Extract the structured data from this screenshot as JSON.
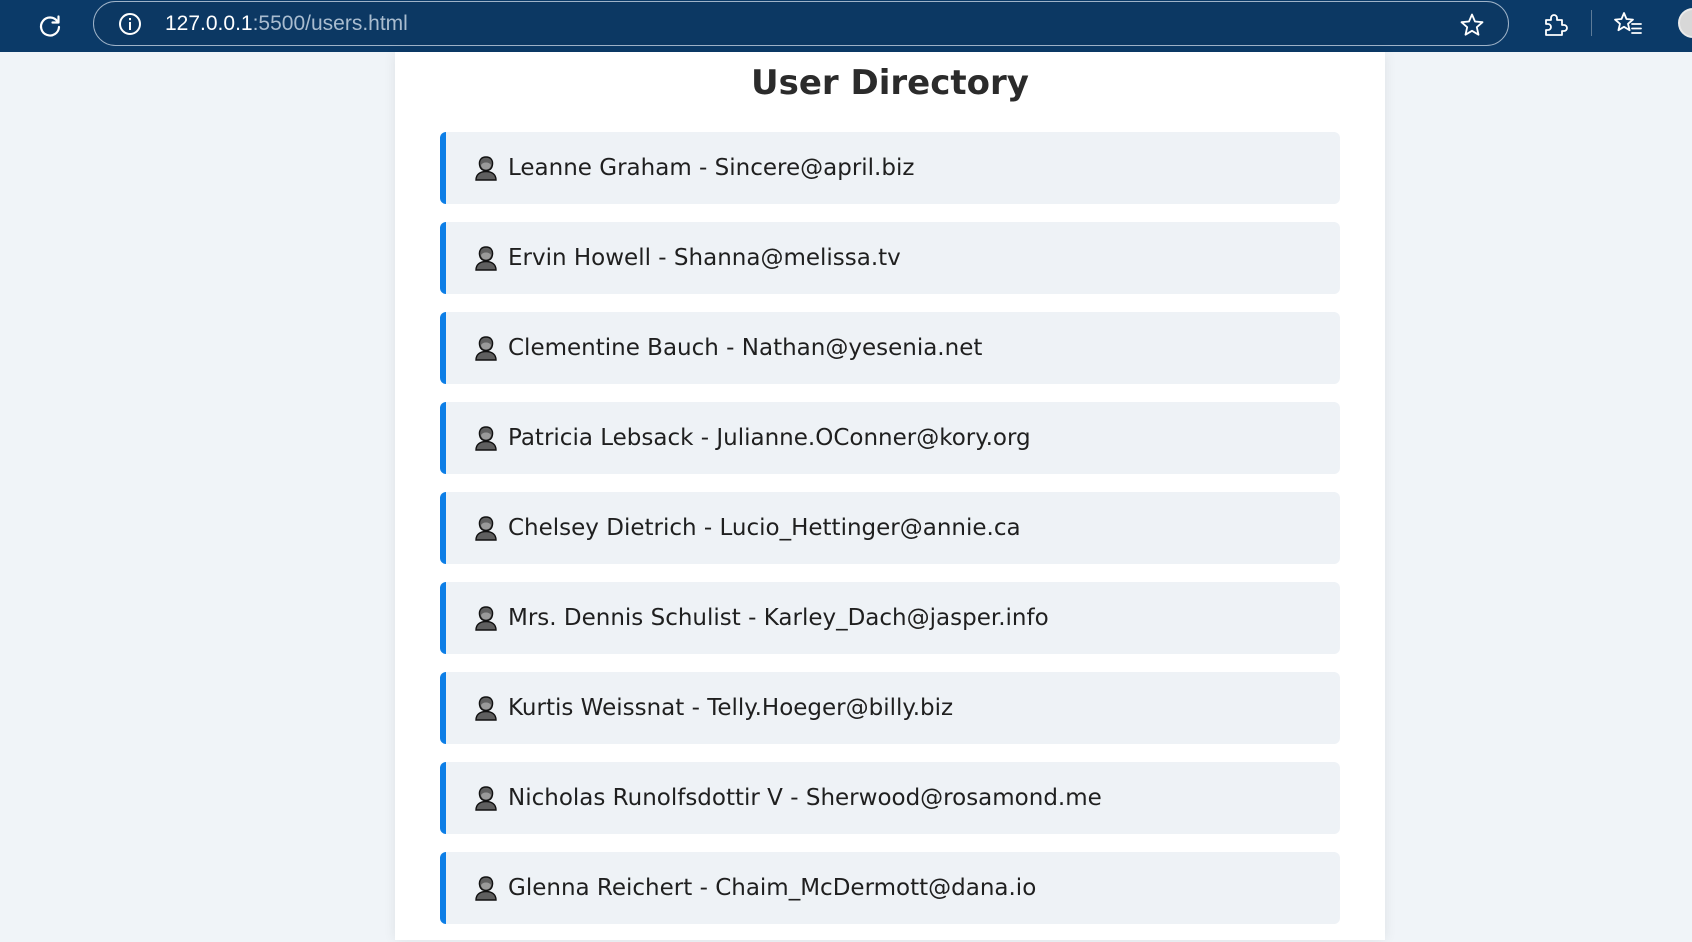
{
  "browser": {
    "url_host": "127.0.0.1",
    "url_path": ":5500/users.html",
    "icons": {
      "reload": "reload-icon",
      "info": "info-icon",
      "bookmark": "star-icon",
      "extensions": "puzzle-icon",
      "favorites": "favorites-icon"
    },
    "colors": {
      "toolbar": "#0b3a68",
      "url_host": "#ffffff",
      "url_path": "#a9bccf"
    }
  },
  "page": {
    "title": "User Directory",
    "accent_color": "#0d7ee6",
    "item_background": "#eef2f6",
    "background": "#f0f4f8",
    "user_icon": "person-icon",
    "users": [
      {
        "name": "Leanne Graham",
        "separator": " - ",
        "email": "Sincere@april.biz"
      },
      {
        "name": "Ervin Howell",
        "separator": " - ",
        "email": "Shanna@melissa.tv"
      },
      {
        "name": "Clementine Bauch",
        "separator": " - ",
        "email": "Nathan@yesenia.net"
      },
      {
        "name": "Patricia Lebsack",
        "separator": " - ",
        "email": "Julianne.OConner@kory.org"
      },
      {
        "name": "Chelsey Dietrich",
        "separator": " - ",
        "email": "Lucio_Hettinger@annie.ca"
      },
      {
        "name": "Mrs. Dennis Schulist",
        "separator": " - ",
        "email": "Karley_Dach@jasper.info"
      },
      {
        "name": "Kurtis Weissnat",
        "separator": " - ",
        "email": "Telly.Hoeger@billy.biz"
      },
      {
        "name": "Nicholas Runolfsdottir V",
        "separator": " - ",
        "email": "Sherwood@rosamond.me"
      },
      {
        "name": "Glenna Reichert",
        "separator": " - ",
        "email": "Chaim_McDermott@dana.io"
      }
    ]
  }
}
